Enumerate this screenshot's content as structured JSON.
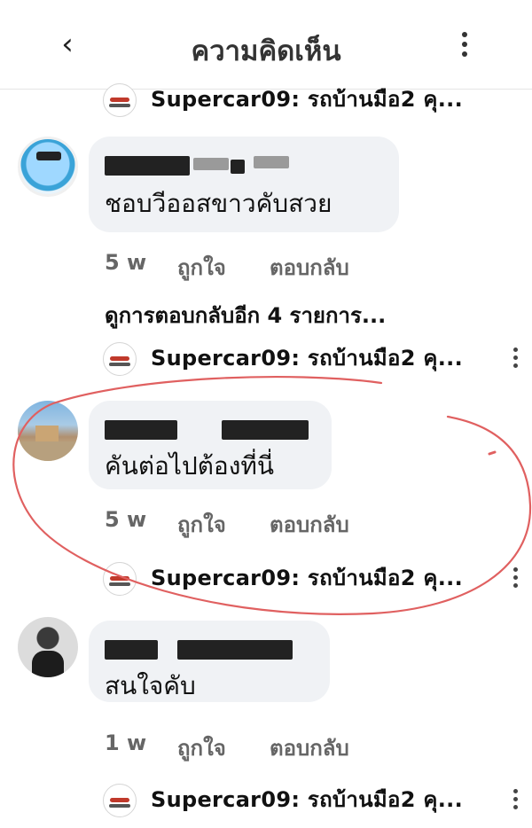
{
  "header": {
    "title": "ความคิดเห็น",
    "back_icon": "chevron-left-icon",
    "more_icon": "vertical-dots-icon"
  },
  "reply_preview": "Supercar09: รถบ้านมือ2 คุ...",
  "reply_preview_top": "Supercar09: รถบ้านมือ2 คุ...",
  "comments": [
    {
      "text": "ชอบวีออสขาวคับสวย",
      "time": "5 w",
      "like": "ถูกใจ",
      "reply": "ตอบกลับ",
      "more_replies": "ดูการตอบกลับอีก 4 รายการ..."
    },
    {
      "text": "คันต่อไปต้องที่นี่",
      "time": "5 w",
      "like": "ถูกใจ",
      "reply": "ตอบกลับ"
    },
    {
      "text": "สนใจคับ",
      "time": "1 w",
      "like": "ถูกใจ",
      "reply": "ตอบกลับ"
    }
  ],
  "annotation_color": "#e06060"
}
